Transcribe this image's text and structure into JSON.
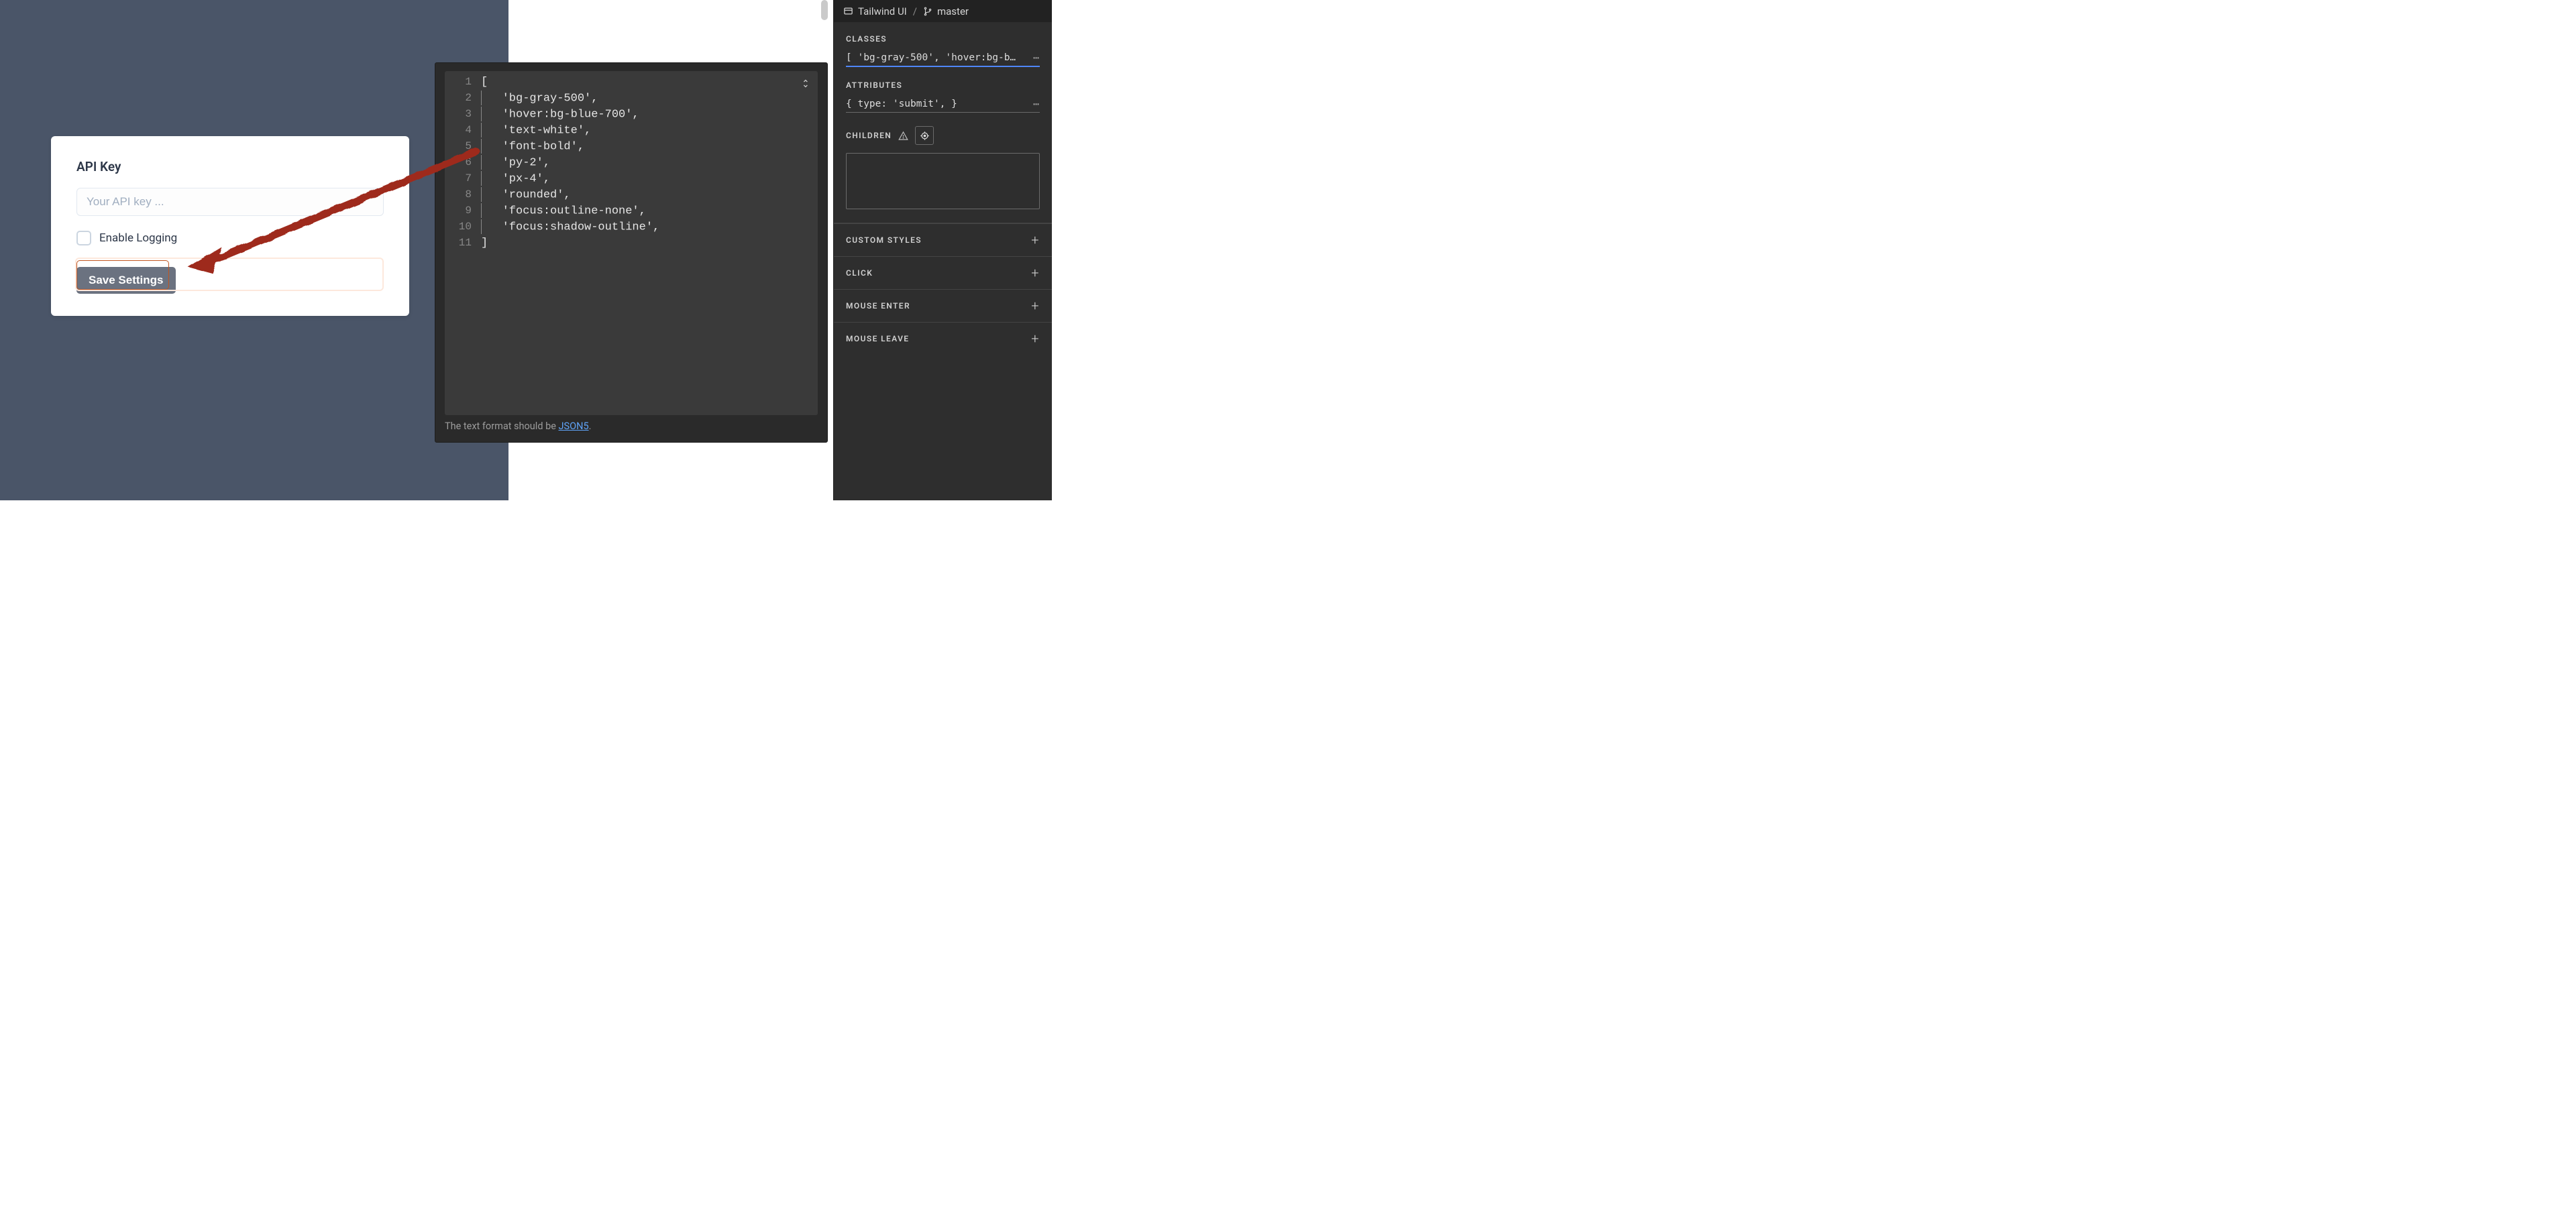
{
  "card": {
    "title": "API Key",
    "api_placeholder": "Your API key ...",
    "enable_logging_label": "Enable Logging",
    "save_button": "Save Settings"
  },
  "editor": {
    "lines": [
      "[",
      "    'bg-gray-500',",
      "    'hover:bg-blue-700',",
      "    'text-white',",
      "    'font-bold',",
      "    'py-2',",
      "    'px-4',",
      "    'rounded',",
      "    'focus:outline-none',",
      "    'focus:shadow-outline',",
      "]"
    ],
    "footer_prefix": "The text format should be ",
    "footer_link": "JSON5",
    "footer_suffix": "."
  },
  "panel": {
    "breadcrumb_project": "Tailwind UI",
    "breadcrumb_branch": "master",
    "classes_label": "CLASSES",
    "classes_value": "[ 'bg-gray-500', 'hover:bg-b…",
    "attributes_label": "ATTRIBUTES",
    "attributes_value": "{ type: 'submit', }",
    "children_label": "CHILDREN",
    "expanders": [
      {
        "label": "CUSTOM STYLES"
      },
      {
        "label": "CLICK"
      },
      {
        "label": "MOUSE ENTER"
      },
      {
        "label": "MOUSE LEAVE"
      }
    ]
  }
}
